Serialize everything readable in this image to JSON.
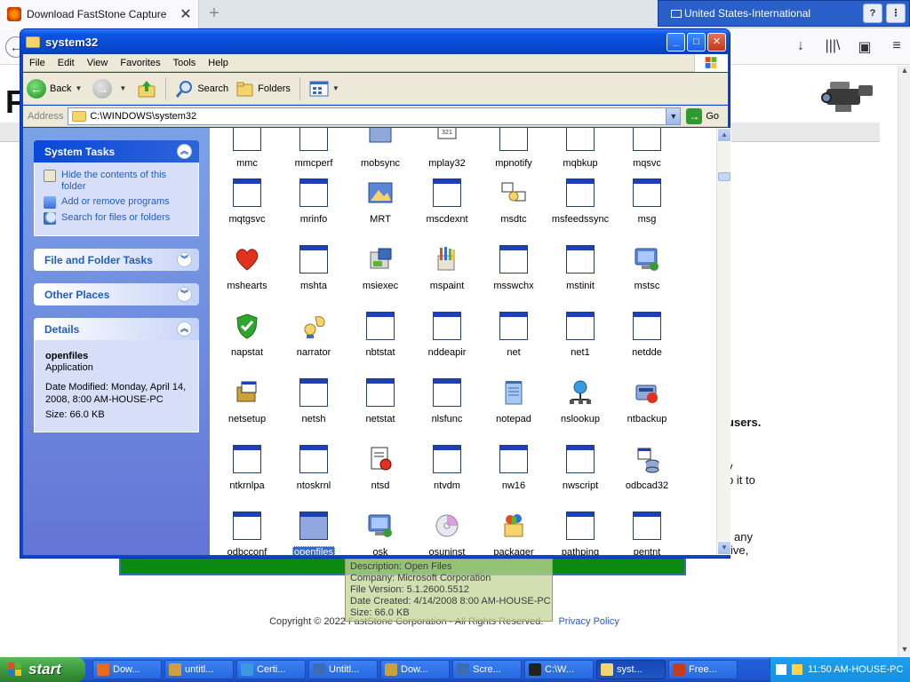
{
  "browser": {
    "tab_title": "Download FastStone Capture",
    "tab_close": "✕",
    "new_tab": "+",
    "back": "←",
    "nav_icons": [
      "↓",
      "|||\\",
      "▣",
      "≡"
    ],
    "page_fragment_f": "F",
    "text_fragments": [
      "users.",
      "y",
      "p it to",
      "any",
      "ive,"
    ],
    "footer_text": "Copyright © 2022 FastStone Corporation - All Rights Reserved.",
    "footer_link": "Privacy Policy"
  },
  "langbar": {
    "language": "United States-International",
    "help": "?"
  },
  "explorer": {
    "title": "system32",
    "window_buttons": {
      "minimize": "_",
      "maximize": "□",
      "close": "✕"
    },
    "menu": [
      "File",
      "Edit",
      "View",
      "Favorites",
      "Tools",
      "Help"
    ],
    "toolbar": {
      "back": "Back",
      "search": "Search",
      "folders": "Folders"
    },
    "address": {
      "label": "Address",
      "value": "C:\\WINDOWS\\system32",
      "go": "Go"
    },
    "panels": {
      "system_tasks": {
        "title": "System Tasks",
        "links": [
          "Hide the contents of this folder",
          "Add or remove programs",
          "Search for files or folders"
        ]
      },
      "file_folder_tasks": {
        "title": "File and Folder Tasks"
      },
      "other_places": {
        "title": "Other Places"
      },
      "details": {
        "title": "Details",
        "name": "openfiles",
        "type": "Application",
        "modified": "Date Modified: Monday, April 14, 2008, 8:00 AM-HOUSE-PC",
        "size": "Size: 66.0 KB"
      }
    },
    "files": [
      [
        "mmc",
        "mmcperf",
        "mobsync",
        "mplay32",
        "mpnotify",
        "mqbkup",
        "mqsvc"
      ],
      [
        "mqtgsvc",
        "mrinfo",
        "MRT",
        "mscdexnt",
        "msdtc",
        "msfeedssync",
        "msg"
      ],
      [
        "mshearts",
        "mshta",
        "msiexec",
        "mspaint",
        "msswchx",
        "mstinit",
        "mstsc"
      ],
      [
        "napstat",
        "narrator",
        "nbtstat",
        "nddeapir",
        "net",
        "net1",
        "netdde"
      ],
      [
        "netsetup",
        "netsh",
        "netstat",
        "nlsfunc",
        "notepad",
        "nslookup",
        "ntbackup"
      ],
      [
        "ntkrnlpa",
        "ntoskrnl",
        "ntsd",
        "ntvdm",
        "nw16",
        "nwscript",
        "odbcad32"
      ],
      [
        "odbcconf",
        "openfiles",
        "osk",
        "osuninst",
        "packager",
        "pathping",
        "pentnt"
      ]
    ],
    "selected_file": "openfiles",
    "mplay32_badge": "321"
  },
  "tooltip": {
    "lines": [
      "Description: Open Files",
      "Company: Microsoft Corporation",
      "File Version: 5.1.2600.5512",
      "Date Created: 4/14/2008 8:00 AM-HOUSE-PC",
      "Size: 66.0 KB"
    ]
  },
  "taskbar": {
    "start": "start",
    "tasks": [
      "Dow...",
      "untitl...",
      "Certi...",
      "Untitl...",
      "Dow...",
      "Scre...",
      "C:\\W...",
      "syst...",
      "Free..."
    ],
    "active_task_index": 7,
    "clock": "11:50 AM-HOUSE-PC"
  },
  "colors": {
    "xp_blue": "#0a47d0",
    "taskbar_blue": "#245edb",
    "start_green": "#3c9a3c",
    "panel_link": "#215dc6"
  }
}
